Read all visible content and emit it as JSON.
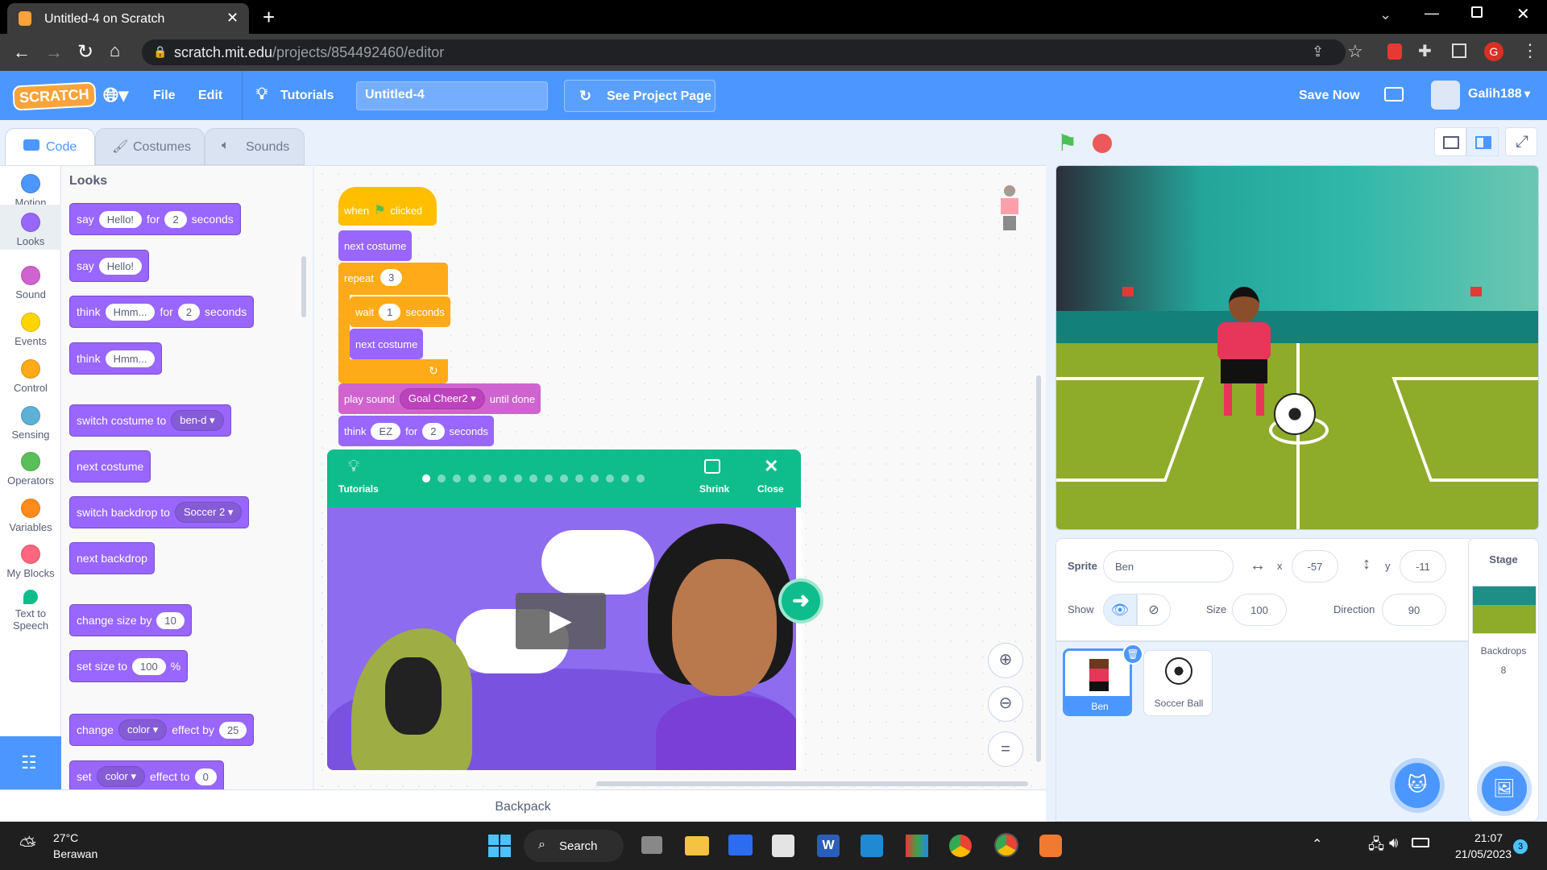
{
  "browser": {
    "tab_title": "Untitled-4 on Scratch",
    "url_host": "scratch.mit.edu",
    "url_path": "/projects/854492460/editor",
    "profile_initial": "G"
  },
  "menubar": {
    "logo": "SCRATCH",
    "file": "File",
    "edit": "Edit",
    "tutorials": "Tutorials",
    "project_title": "Untitled-4",
    "see_project_page": "See Project Page",
    "save_now": "Save Now",
    "username": "Galih188"
  },
  "editor_tabs": {
    "code": "Code",
    "costumes": "Costumes",
    "sounds": "Sounds"
  },
  "categories": [
    {
      "label": "Motion",
      "color": "#4c97ff"
    },
    {
      "label": "Looks",
      "color": "#9966ff"
    },
    {
      "label": "Sound",
      "color": "#cf63cf"
    },
    {
      "label": "Events",
      "color": "#ffd500"
    },
    {
      "label": "Control",
      "color": "#ffab19"
    },
    {
      "label": "Sensing",
      "color": "#5cb1d6"
    },
    {
      "label": "Operators",
      "color": "#59c059"
    },
    {
      "label": "Variables",
      "color": "#ff8c1a"
    },
    {
      "label": "My Blocks",
      "color": "#ff6680"
    },
    {
      "label": "Text to Speech",
      "color": "#0fbd8c"
    }
  ],
  "palette": {
    "heading": "Looks",
    "say1": {
      "a": "say",
      "msg": "Hello!",
      "for": "for",
      "num": "2",
      "unit": "seconds"
    },
    "say2": {
      "a": "say",
      "msg": "Hello!"
    },
    "think1": {
      "a": "think",
      "msg": "Hmm...",
      "for": "for",
      "num": "2",
      "unit": "seconds"
    },
    "think2": {
      "a": "think",
      "msg": "Hmm..."
    },
    "switch_costume": {
      "a": "switch costume to",
      "val": "ben-d"
    },
    "next_costume": "next costume",
    "switch_backdrop": {
      "a": "switch backdrop to",
      "val": "Soccer 2"
    },
    "next_backdrop": "next backdrop",
    "change_size": {
      "a": "change size by",
      "num": "10"
    },
    "set_size": {
      "a": "set size to",
      "num": "100",
      "pct": "%"
    },
    "change_effect": {
      "a": "change",
      "val": "color",
      "b": "effect by",
      "num": "25"
    },
    "set_effect": {
      "a": "set",
      "val": "color",
      "b": "effect to",
      "num": "0"
    }
  },
  "script": {
    "hat": {
      "when": "when",
      "clicked": "clicked"
    },
    "next_costume": "next costume",
    "repeat": {
      "a": "repeat",
      "num": "3"
    },
    "wait": {
      "a": "wait",
      "num": "1",
      "unit": "seconds"
    },
    "inner_next": "next costume",
    "play_sound": {
      "a": "play sound",
      "val": "Goal Cheer2",
      "b": "until done"
    },
    "think": {
      "a": "think",
      "msg": "EZ",
      "for": "for",
      "num": "2",
      "unit": "seconds"
    }
  },
  "tutorial": {
    "label": "Tutorials",
    "shrink": "Shrink",
    "close": "Close",
    "steps": 15,
    "current": 0
  },
  "backpack": "Backpack",
  "sprite_info": {
    "sprite_label": "Sprite",
    "sprite_name": "Ben",
    "x_label": "x",
    "x": "-57",
    "y_label": "y",
    "y": "-11",
    "show_label": "Show",
    "size_label": "Size",
    "size": "100",
    "direction_label": "Direction",
    "direction": "90"
  },
  "sprites": [
    {
      "name": "Ben"
    },
    {
      "name": "Soccer Ball"
    }
  ],
  "stage_pane": {
    "title": "Stage",
    "backdrops_label": "Backdrops",
    "backdrops_count": "8"
  },
  "taskbar": {
    "temp": "27°C",
    "weather": "Berawan",
    "search": "Search",
    "time": "21:07",
    "date": "21/05/2023",
    "badge": "3"
  }
}
